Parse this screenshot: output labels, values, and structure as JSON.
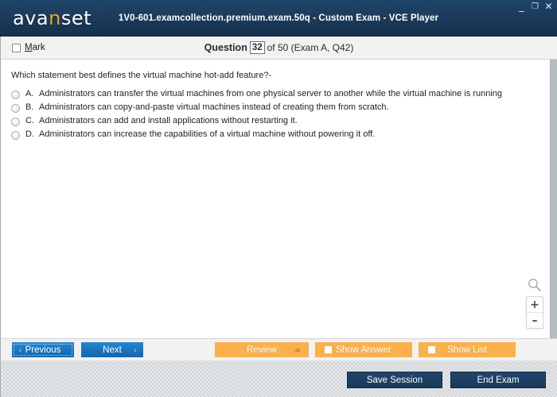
{
  "window": {
    "logo_text_a": "ava",
    "logo_text_n": "n",
    "logo_text_b": "set",
    "title": "1V0-601.examcollection.premium.exam.50q - Custom Exam - VCE Player",
    "minimize_glyph": "_",
    "maximize_glyph": "❐",
    "close_glyph": "✕"
  },
  "sub_header": {
    "mark_label_mnemonic": "M",
    "mark_label_rest": "ark",
    "question_word": "Question",
    "question_number": "32",
    "question_suffix": "of 50 (Exam A, Q42)"
  },
  "question": {
    "stem": "Which statement best defines the virtual machine hot-add feature?-",
    "options": [
      {
        "letter": "A.",
        "text": "Administrators can transfer the virtual machines from one physical server to another while the virtual machine is running"
      },
      {
        "letter": "B.",
        "text": "Administrators can copy-and-paste virtual machines instead of creating them from scratch."
      },
      {
        "letter": "C.",
        "text": "Administrators can add and install applications without restarting it."
      },
      {
        "letter": "D.",
        "text": "Administrators can increase the capabilities of a virtual machine without powering it off."
      }
    ]
  },
  "zoom_controls": {
    "zoom_in_label": "+",
    "zoom_out_label": "–"
  },
  "toolbar": {
    "previous_label": "Previous",
    "previous_chevron": "‹",
    "next_label": "Next",
    "next_chevron": "›",
    "review_label": "Review",
    "show_answer_label": "Show Answer",
    "show_list_label": "Show List"
  },
  "footer": {
    "save_session_label": "Save Session",
    "end_exam_label": "End Exam"
  },
  "colors": {
    "header_navy": "#1b4468",
    "accent_orange": "#f5a623",
    "button_blue": "#1c74bd",
    "button_orange": "#fbb04e",
    "button_navy": "#20456a"
  }
}
